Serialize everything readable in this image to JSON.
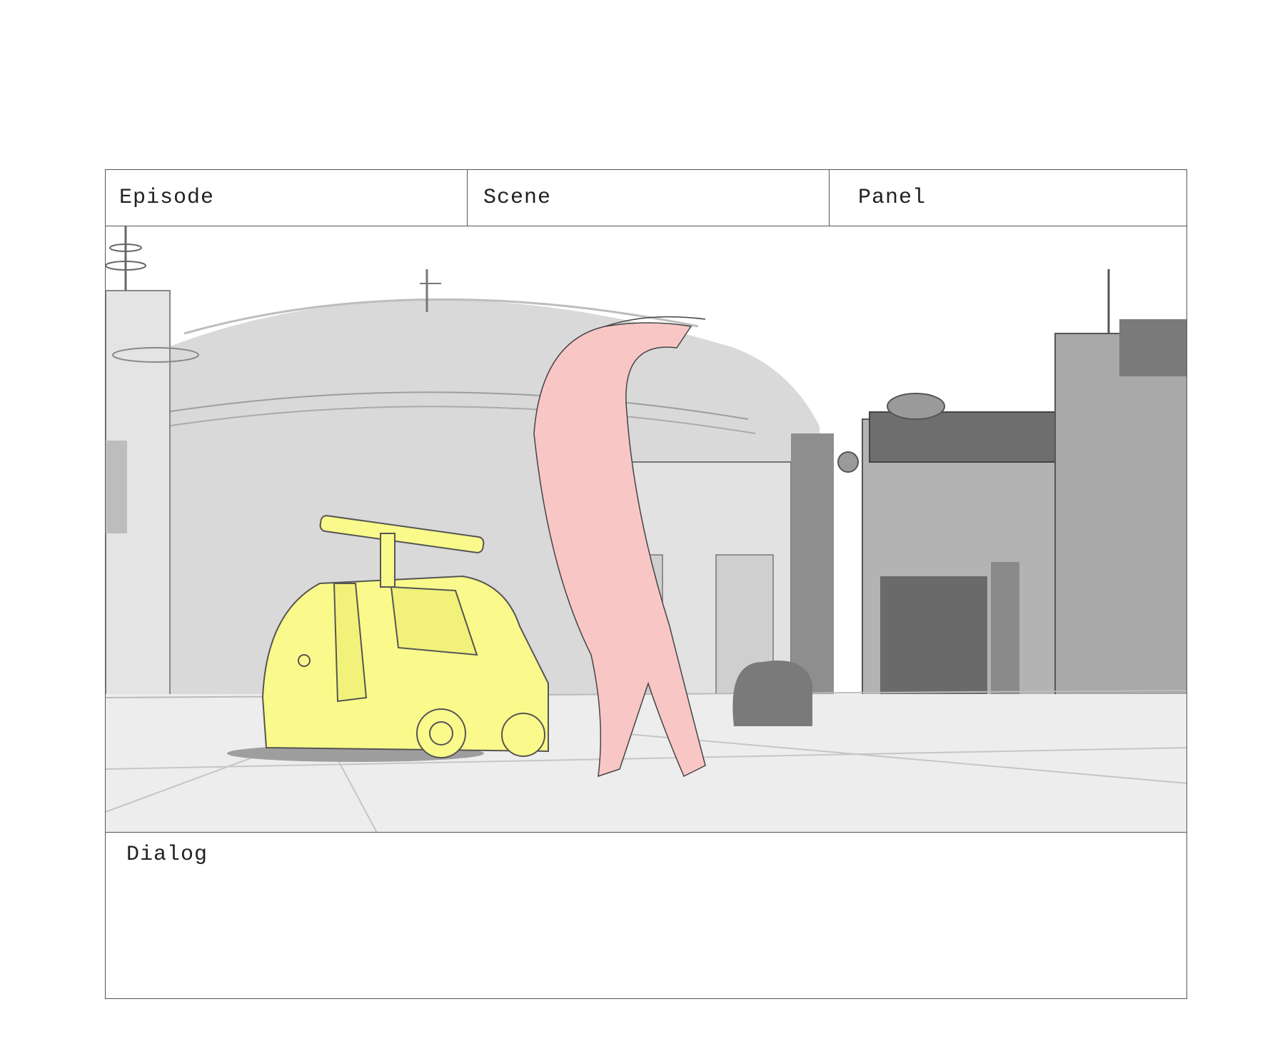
{
  "header": {
    "episode_label": "Episode",
    "scene_label": "Scene",
    "panel_label": "Panel"
  },
  "dialog": {
    "label": "Dialog"
  },
  "illustration": {
    "colors": {
      "van": "#fafa8c",
      "creature": "#f9c6c6",
      "dome": "#d6d6d6",
      "buildings_dark": "#8a8a8a",
      "buildings_mid": "#b8b8b8",
      "ground": "#eeeeee"
    }
  }
}
